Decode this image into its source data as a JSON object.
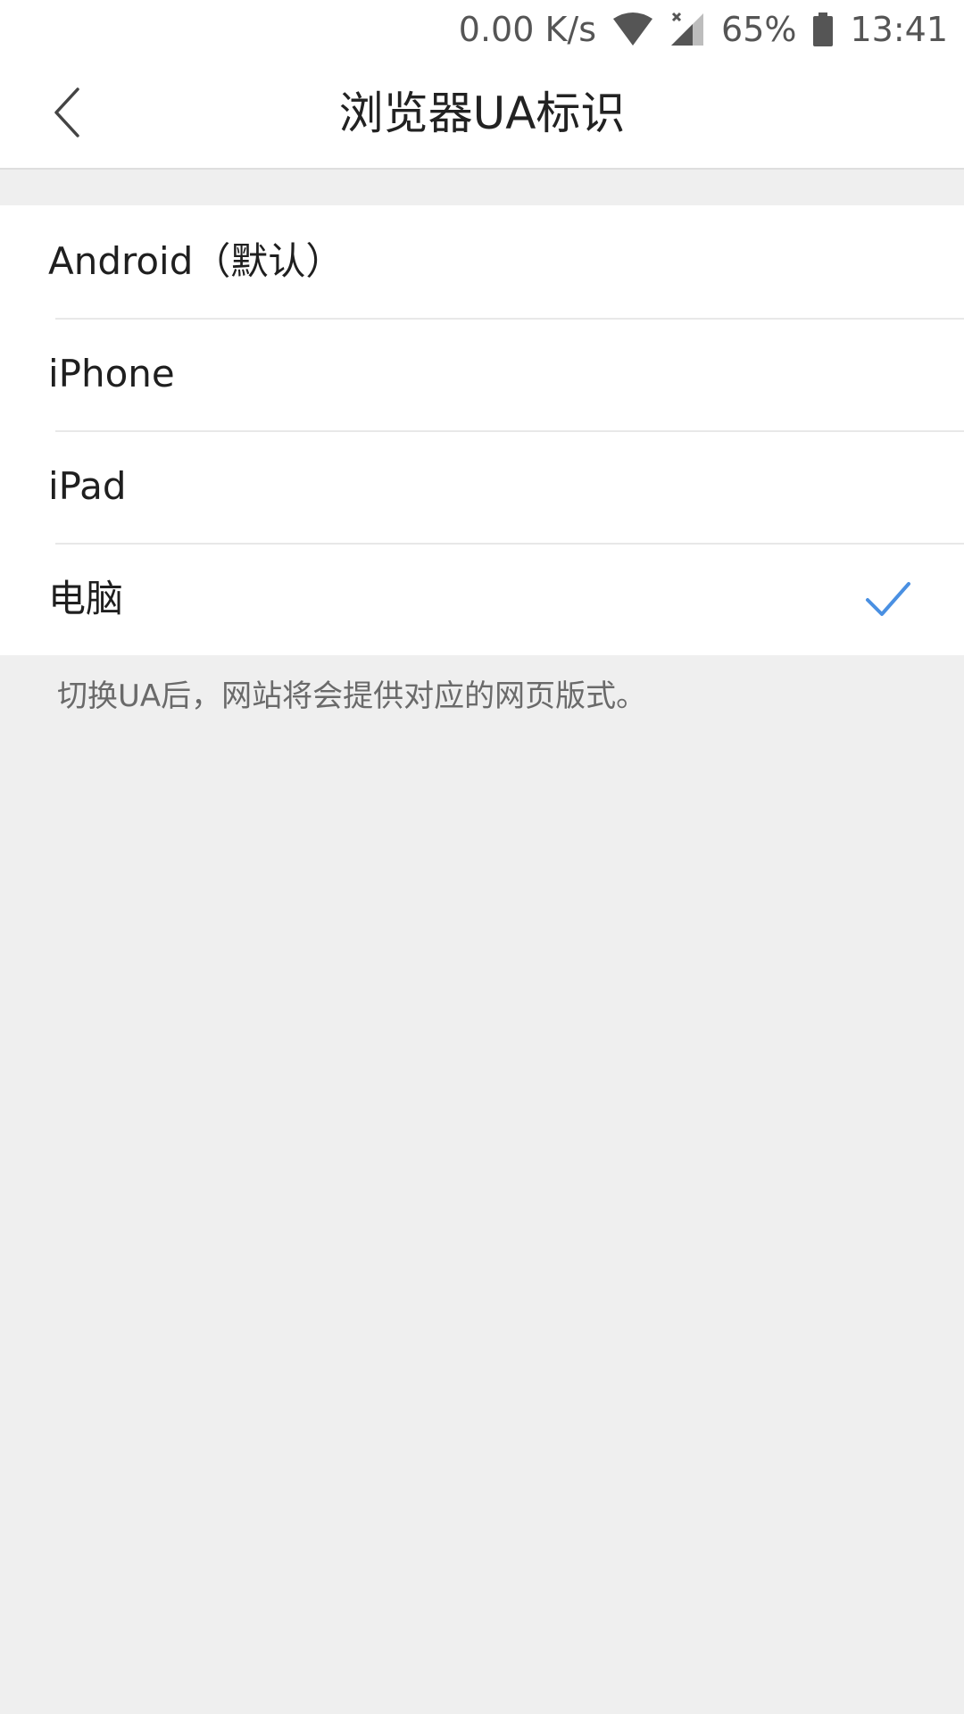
{
  "status_bar": {
    "network_speed": "0.00 K/s",
    "battery_percent": "65%",
    "time": "13:41"
  },
  "header": {
    "title": "浏览器UA标识"
  },
  "options": [
    {
      "label": "Android（默认）",
      "selected": false
    },
    {
      "label": "iPhone",
      "selected": false
    },
    {
      "label": "iPad",
      "selected": false
    },
    {
      "label": "电脑",
      "selected": true
    }
  ],
  "hint": "切换UA后，网站将会提供对应的网页版式。",
  "colors": {
    "accent": "#4a90e2",
    "background": "#efefef",
    "surface": "#ffffff"
  },
  "icons": {
    "back": "chevron-left-icon",
    "check": "check-icon",
    "wifi": "wifi-icon",
    "signal": "signal-icon",
    "battery": "battery-icon"
  }
}
